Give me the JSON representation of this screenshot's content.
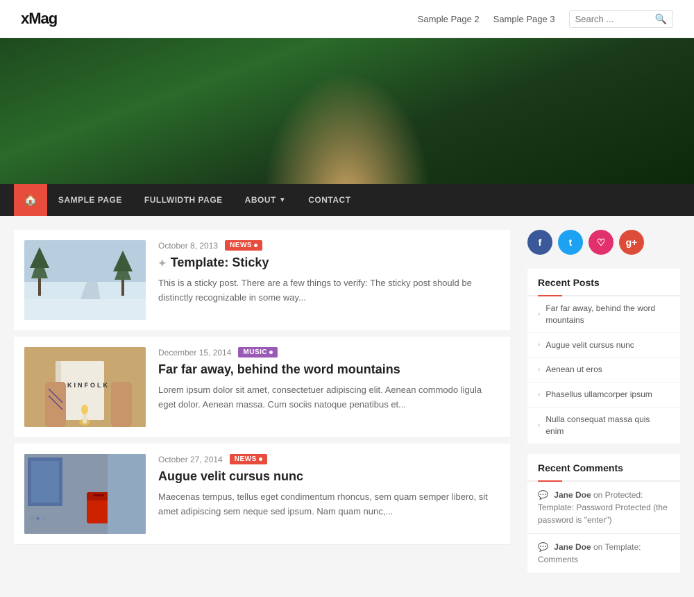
{
  "site": {
    "logo": "xMag"
  },
  "header": {
    "nav_links": [
      "Sample Page 2",
      "Sample Page 3"
    ],
    "search_placeholder": "Search ..."
  },
  "main_nav": {
    "home_icon": "🏠",
    "items": [
      {
        "label": "SAMPLE PAGE",
        "has_dropdown": false
      },
      {
        "label": "FULLWIDTH PAGE",
        "has_dropdown": false
      },
      {
        "label": "ABOUT",
        "has_dropdown": true
      },
      {
        "label": "CONTACT",
        "has_dropdown": false
      }
    ]
  },
  "posts": [
    {
      "date": "October 8, 2013",
      "tag": "NEWS",
      "tag_type": "news",
      "title": "Template: Sticky",
      "sticky": true,
      "excerpt": "This is a sticky post. There are a few things to verify: The sticky post should be distinctly recognizable in some way...",
      "thumb_type": "winter"
    },
    {
      "date": "December 15, 2014",
      "tag": "MUSIC",
      "tag_type": "music",
      "title": "Far far away, behind the word mountains",
      "sticky": false,
      "excerpt": "Lorem ipsum dolor sit amet, consectetuer adipiscing elit. Aenean commodo ligula eget dolor. Aenean massa. Cum sociis natoque penatibus et...",
      "thumb_type": "kinfolk"
    },
    {
      "date": "October 27, 2014",
      "tag": "NEWS",
      "tag_type": "news",
      "title": "Augue velit cursus nunc",
      "sticky": false,
      "excerpt": "Maecenas tempus, tellus eget condimentum rhoncus, sem quam semper libero, sit amet adipiscing sem neque sed ipsum. Nam quam nunc,...",
      "thumb_type": "street"
    }
  ],
  "sidebar": {
    "social": {
      "facebook_label": "f",
      "twitter_label": "t",
      "instagram_label": "♡",
      "googleplus_label": "g+"
    },
    "recent_posts_title": "Recent Posts",
    "recent_posts": [
      "Far far away, behind the word mountains",
      "Augue velit cursus nunc",
      "Aenean ut eros",
      "Phasellus ullamcorper ipsum",
      "Nulla consequat massa quis enim"
    ],
    "recent_comments_title": "Recent Comments",
    "recent_comments": [
      {
        "author": "Jane Doe",
        "text": "on Protected: Template: Password Protected (the password is \"enter\")"
      },
      {
        "author": "Jane Doe",
        "text": "on Template: Comments"
      }
    ]
  }
}
